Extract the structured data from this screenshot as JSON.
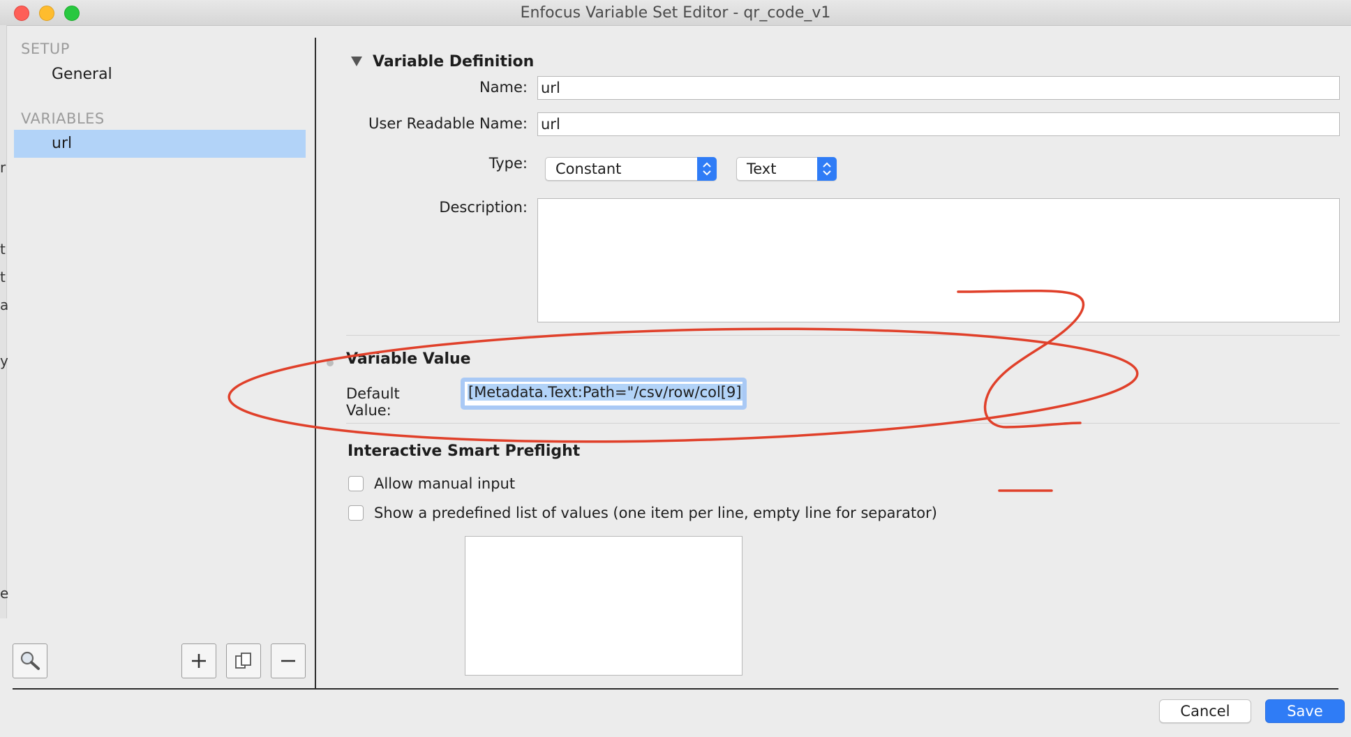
{
  "window": {
    "title": "Enfocus Variable Set Editor - qr_code_v1"
  },
  "left_edge_glyphs": [
    "r",
    "t",
    "t",
    "a",
    "y",
    "e"
  ],
  "sidebar": {
    "setup_header": "SETUP",
    "setup_items": [
      {
        "label": "General"
      }
    ],
    "variables_header": "VARIABLES",
    "variable_items": [
      {
        "label": "url",
        "selected": true
      }
    ],
    "tools": {
      "search": "search-icon",
      "add": "plus-icon",
      "duplicate": "duplicate-icon",
      "remove": "minus-icon"
    }
  },
  "definition": {
    "section_title": "Variable Definition",
    "name_label": "Name:",
    "name_value": "url",
    "readable_label": "User Readable Name:",
    "readable_value": "url",
    "type_label": "Type:",
    "type_selected": "Constant",
    "subtype_selected": "Text",
    "description_label": "Description:",
    "description_value": ""
  },
  "value": {
    "section_title": "Variable Value",
    "default_label": "Default Value:",
    "default_value": "[Metadata.Text:Path=\"/csv/row/col[9]'"
  },
  "preflight": {
    "section_title": "Interactive Smart Preflight",
    "allow_manual_label": "Allow manual input",
    "allow_manual_checked": false,
    "predefined_label": "Show a predefined list of values (one item per line, empty line for separator)",
    "predefined_checked": false,
    "values_list": ""
  },
  "footer": {
    "cancel_label": "Cancel",
    "save_label": "Save"
  },
  "colors": {
    "accent": "#2f7cf6",
    "selection": "#b2d3f8",
    "annotation": "#e0402a"
  }
}
